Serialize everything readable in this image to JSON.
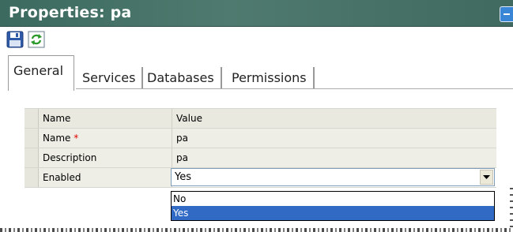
{
  "window": {
    "title": "Properties: pa"
  },
  "toolbar": {
    "save_icon": "save-icon",
    "refresh_icon": "refresh-icon"
  },
  "tabs": [
    {
      "label": "General",
      "active": true
    },
    {
      "label": "Services",
      "active": false
    },
    {
      "label": "Databases",
      "active": false
    },
    {
      "label": "Permissions",
      "active": false
    }
  ],
  "grid": {
    "header": {
      "name": "Name",
      "value": "Value"
    },
    "rows": [
      {
        "name": "Name",
        "required_mark": "*",
        "value": "pa"
      },
      {
        "name": "Description",
        "value": "pa"
      },
      {
        "name": "Enabled",
        "value": "Yes"
      }
    ]
  },
  "dropdown": {
    "options": [
      "No",
      "Yes"
    ],
    "selected": "Yes"
  },
  "colors": {
    "titlebar": "#3b695e",
    "selection": "#316ac5",
    "required": "#e00000"
  }
}
